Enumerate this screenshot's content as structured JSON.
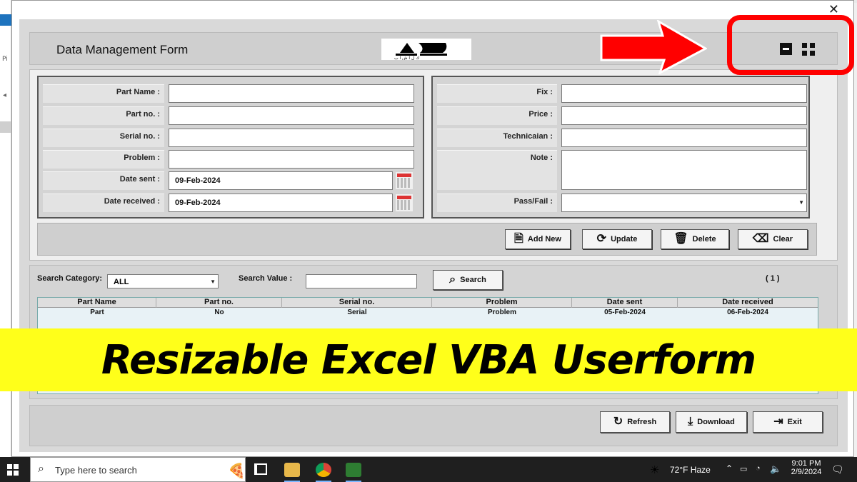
{
  "window": {
    "close_glyph": "✕"
  },
  "header": {
    "title": "Data Management Form",
    "logo_text": "AS"
  },
  "left_fields": [
    {
      "label": "Part Name :",
      "value": ""
    },
    {
      "label": "Part no. :",
      "value": ""
    },
    {
      "label": "Serial no. :",
      "value": ""
    },
    {
      "label": "Problem :",
      "value": ""
    },
    {
      "label": "Date sent :",
      "value": "09-Feb-2024"
    },
    {
      "label": "Date received :",
      "value": "09-Feb-2024"
    }
  ],
  "right_fields": [
    {
      "label": "Fix :",
      "value": ""
    },
    {
      "label": "Price :",
      "value": ""
    },
    {
      "label": "Technicaian :",
      "value": ""
    },
    {
      "label": "Note :",
      "value": ""
    },
    {
      "label": "Pass/Fail :",
      "value": ""
    }
  ],
  "actions": {
    "add_new": "Add New",
    "update": "Update",
    "delete": "Delete",
    "clear": "Clear"
  },
  "search": {
    "category_label": "Search Category:",
    "category_value": "ALL",
    "value_label": "Search Value :",
    "value": "",
    "button": "Search",
    "count": "( 1 )"
  },
  "list": {
    "columns": [
      "Part Name",
      "Part no.",
      "Serial no.",
      "Problem",
      "Date sent",
      "Date received"
    ],
    "rows": [
      [
        "Part",
        "No",
        "Serial",
        "Problem",
        "05-Feb-2024",
        "06-Feb-2024"
      ]
    ]
  },
  "footer": {
    "refresh": "Refresh",
    "download": "Download",
    "exit": "Exit"
  },
  "banner": {
    "text": "Resizable Excel VBA Userform",
    "color": "#ffff1a"
  },
  "annotation": {
    "color": "#ff0000"
  },
  "taskbar": {
    "search_placeholder": "Type here to search",
    "weather": "72°F  Haze",
    "time": "9:01 PM",
    "date": "2/9/2024"
  }
}
